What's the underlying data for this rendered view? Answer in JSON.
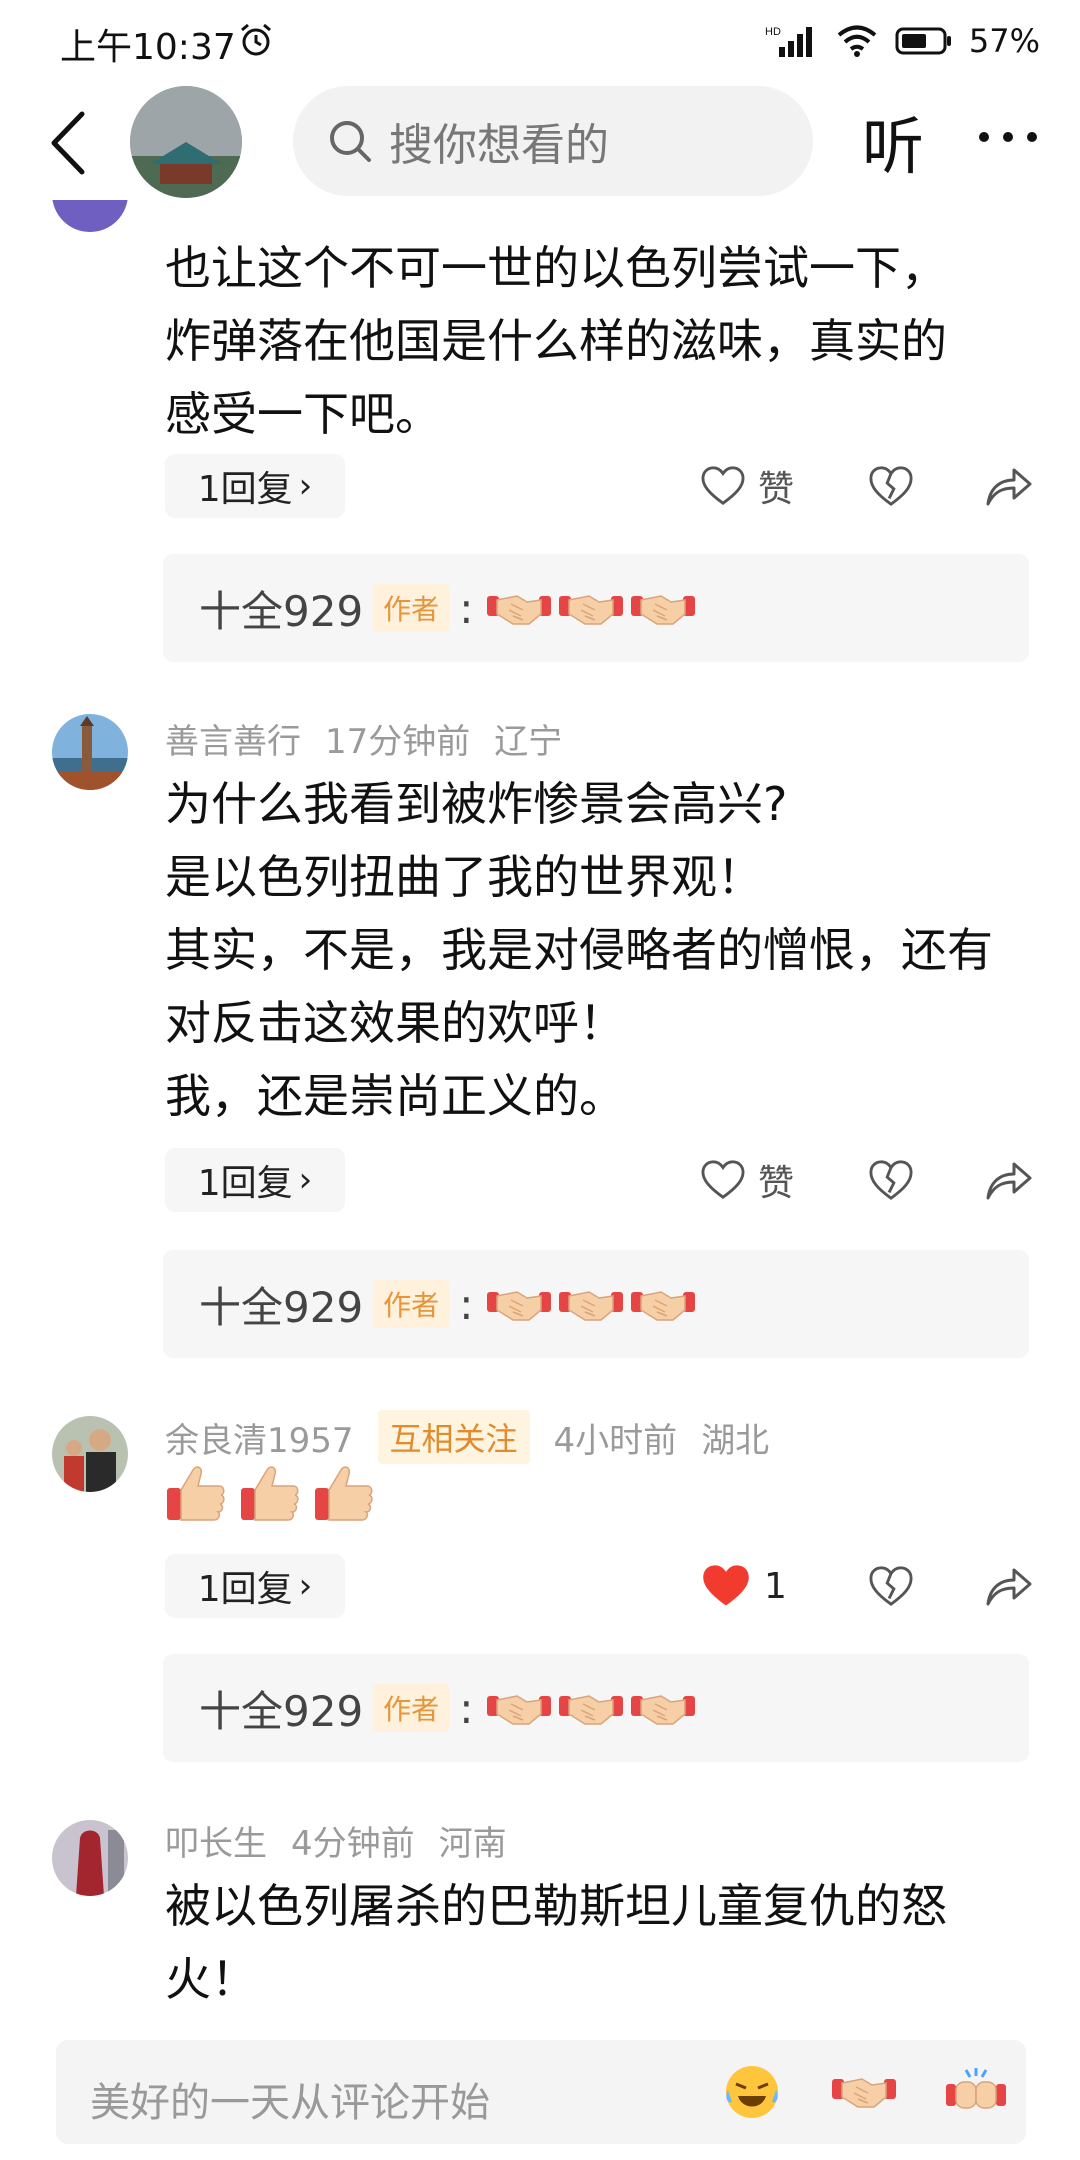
{
  "status": {
    "time": "上午10:37",
    "battery": "57%",
    "network": "HD"
  },
  "header": {
    "search_placeholder": "搜你想看的",
    "listen_label": "听"
  },
  "comments": [
    {
      "lines": [
        "也让这个不可一世的以色列尝试一下，",
        "炸弹落在他国是什么样的滋味，真实的",
        "感受一下吧。"
      ],
      "reply_label": "1回复",
      "like_label": "赞",
      "author_reply": {
        "name": "十全929",
        "badge": "作者",
        "colon": ":"
      }
    },
    {
      "user": "善言善行",
      "time": "17分钟前",
      "location": "辽宁",
      "lines": [
        "为什么我看到被炸惨景会高兴?",
        "是以色列扭曲了我的世界观！",
        "其实，不是，我是对侵略者的憎恨，还有",
        "对反击这效果的欢呼！",
        "我，还是崇尚正义的。"
      ],
      "reply_label": "1回复",
      "like_label": "赞",
      "author_reply": {
        "name": "十全929",
        "badge": "作者",
        "colon": ":"
      }
    },
    {
      "user": "余良清1957",
      "tag": "互相关注",
      "time": "4小时前",
      "location": "湖北",
      "reply_label": "1回复",
      "like_count": "1",
      "author_reply": {
        "name": "十全929",
        "badge": "作者",
        "colon": ":"
      }
    },
    {
      "user": "叩长生",
      "time": "4分钟前",
      "location": "河南",
      "lines": [
        "被以色列屠杀的巴勒斯坦儿童复仇的怒",
        "火！"
      ]
    }
  ],
  "comment_bar": {
    "placeholder": "美好的一天从评论开始"
  },
  "icons": [
    "alarm-icon",
    "signal-icon",
    "wifi-icon",
    "battery-icon",
    "back-icon",
    "search-icon",
    "more-icon",
    "heart-outline-icon",
    "heart-filled-icon",
    "broken-heart-icon",
    "share-icon",
    "handshake-emoji",
    "thumbs-up-emoji",
    "laugh-emoji",
    "fist-bump-emoji"
  ],
  "colors": {
    "like_red": "#f23b2f",
    "author_badge": "#e6953a",
    "follow_tag": "#e08b2e"
  }
}
